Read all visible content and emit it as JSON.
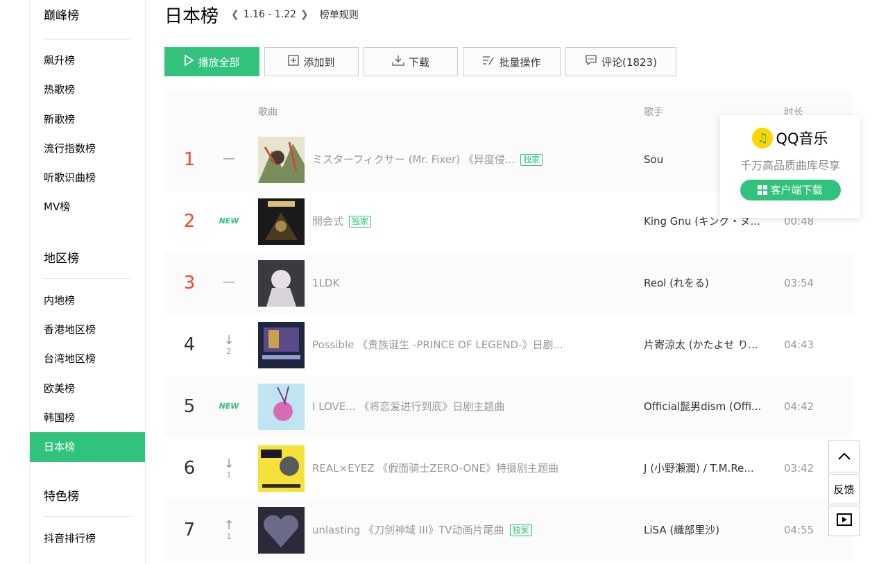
{
  "sidebar": {
    "top_group": "巅峰榜",
    "top_items": [
      "飙升榜",
      "热歌榜",
      "新歌榜",
      "流行指数榜",
      "听歌识曲榜",
      "MV榜"
    ],
    "region_group": "地区榜",
    "region_items": [
      "内地榜",
      "香港地区榜",
      "台湾地区榜",
      "欧美榜",
      "韩国榜",
      "日本榜"
    ],
    "special_group": "特色榜",
    "special_items": [
      "抖音排行榜"
    ],
    "active": "日本榜"
  },
  "header": {
    "title": "日本榜",
    "period": "1.16 - 1.22",
    "rules": "榜单规则"
  },
  "toolbar": {
    "play_all": "播放全部",
    "add_to": "添加到",
    "download": "下载",
    "batch": "批量操作",
    "comments": "评论(1823)"
  },
  "table": {
    "col_song": "歌曲",
    "col_artist": "歌手",
    "col_duration": "时长",
    "rows": [
      {
        "rank": "1",
        "trend": "—",
        "trend_num": "",
        "song": "ミスターフィクサー (Mr. Fixer) 《异度侵...",
        "tag": "独家",
        "artist": "Sou",
        "duration": ""
      },
      {
        "rank": "2",
        "trend": "NEW",
        "trend_num": "",
        "song": "開会式",
        "tag": "独家",
        "artist": "King Gnu (キング・ヌ...",
        "duration": "00:48"
      },
      {
        "rank": "3",
        "trend": "—",
        "trend_num": "",
        "song": "1LDK",
        "tag": "",
        "artist": "Reol (れをる)",
        "duration": "03:54"
      },
      {
        "rank": "4",
        "trend": "↓",
        "trend_num": "2",
        "song": "Possible 《贵族诞生 -PRINCE OF LEGEND-》日剧...",
        "tag": "",
        "artist": "片寄涼太 (かたよせ り...",
        "duration": "04:43"
      },
      {
        "rank": "5",
        "trend": "NEW",
        "trend_num": "",
        "song": "I LOVE... 《将恋爱进行到底》日剧主题曲",
        "tag": "",
        "artist": "Official髭男dism (Offi...",
        "duration": "04:42"
      },
      {
        "rank": "6",
        "trend": "↓",
        "trend_num": "1",
        "song": "REAL×EYEZ 《假面骑士ZERO-ONE》特摄剧主题曲",
        "tag": "",
        "artist": "J (小野瀬潤) / T.M.Re...",
        "duration": "03:42"
      },
      {
        "rank": "7",
        "trend": "↑",
        "trend_num": "1",
        "song": "unlasting 《刀剑神域 III》TV动画片尾曲",
        "tag": "独家",
        "artist": "LiSA (織部里沙)",
        "duration": "04:55"
      }
    ]
  },
  "popup": {
    "brand": "QQ音乐",
    "slogan": "千万高品质曲库尽享",
    "download": "客户端下载"
  },
  "float": {
    "feedback": "反馈"
  },
  "colors": {
    "accent": "#31c27c",
    "rank_top": "#ff4222"
  }
}
